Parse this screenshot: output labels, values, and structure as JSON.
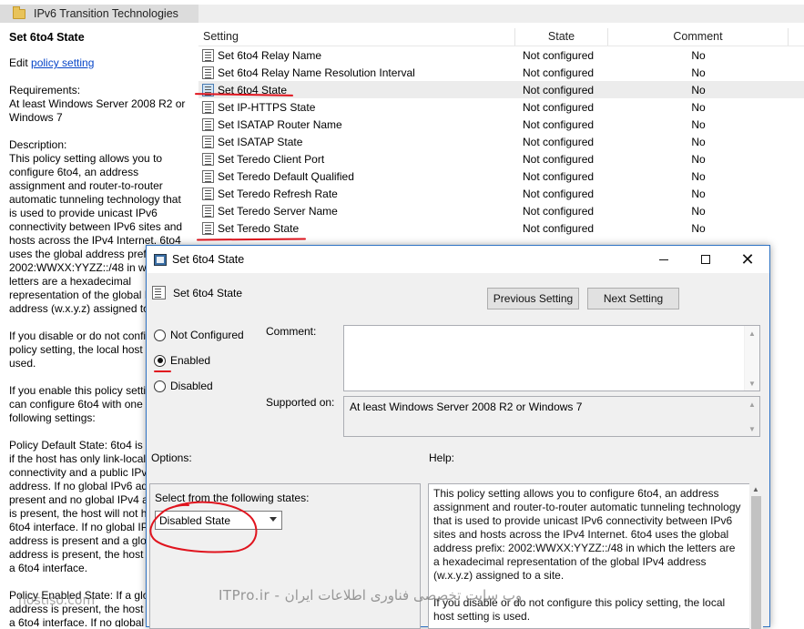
{
  "window": {
    "folder_title": "IPv6 Transition Technologies"
  },
  "left_pane": {
    "title": "Set 6to4 State",
    "edit_prefix": "Edit ",
    "edit_link": "policy setting",
    "requirements": "Requirements:\nAt least Windows Server 2008 R2 or Windows 7",
    "description": "Description:\nThis policy setting allows you to configure 6to4, an address assignment and router-to-router automatic tunneling technology that is used to provide unicast IPv6 connectivity between IPv6 sites and hosts across the IPv4 Internet. 6to4 uses the global address prefix: 2002:WWXX:YYZZ::/48 in which the letters are a hexadecimal representation of the global IPv4 address (w.x.y.z) assigned to a site.",
    "disable_text": "If you disable or do not configure this policy setting, the local host setting is used.",
    "enable_text": "If you enable this policy setting, you can configure 6to4 with one of the following settings:",
    "default_state": "Policy Default State: 6to4 is enabled if the host has only link-local IPv6 connectivity and a public IPv4 address. If no global IPv6 address is present and no global IPv4 address is present, the host will not have a 6to4 interface. If no global IPv6 address is present and a global IPv4 address is present, the host will have a 6to4 interface.",
    "enabled_state": "Policy Enabled State: If a global IPv4 address is present, the host will have a 6to4 interface. If no global"
  },
  "table": {
    "headers": {
      "setting": "Setting",
      "state": "State",
      "comment": "Comment"
    },
    "rows": [
      {
        "name": "Set 6to4 Relay Name",
        "state": "Not configured",
        "comment": "No"
      },
      {
        "name": "Set 6to4 Relay Name Resolution Interval",
        "state": "Not configured",
        "comment": "No"
      },
      {
        "name": "Set 6to4 State",
        "state": "Not configured",
        "comment": "No"
      },
      {
        "name": "Set IP-HTTPS State",
        "state": "Not configured",
        "comment": "No"
      },
      {
        "name": "Set ISATAP Router Name",
        "state": "Not configured",
        "comment": "No"
      },
      {
        "name": "Set ISATAP State",
        "state": "Not configured",
        "comment": "No"
      },
      {
        "name": "Set Teredo Client Port",
        "state": "Not configured",
        "comment": "No"
      },
      {
        "name": "Set Teredo Default Qualified",
        "state": "Not configured",
        "comment": "No"
      },
      {
        "name": "Set Teredo Refresh Rate",
        "state": "Not configured",
        "comment": "No"
      },
      {
        "name": "Set Teredo Server Name",
        "state": "Not configured",
        "comment": "No"
      },
      {
        "name": "Set Teredo State",
        "state": "Not configured",
        "comment": "No"
      }
    ]
  },
  "dialog": {
    "title": "Set 6to4 State",
    "header_label": "Set 6to4 State",
    "prev_button": "Previous Setting",
    "next_button": "Next Setting",
    "radio_not_configured": "Not Configured",
    "radio_enabled": "Enabled",
    "radio_disabled": "Disabled",
    "comment_label": "Comment:",
    "supported_label": "Supported on:",
    "supported_value": "At least Windows Server 2008 R2 or Windows 7",
    "options_label": "Options:",
    "help_label": "Help:",
    "select_label": "Select from the following states:",
    "select_value": "Disabled State",
    "help_p1": "This policy setting allows you to configure 6to4, an address assignment and router-to-router automatic tunneling technology that is used to provide unicast IPv6 connectivity between IPv6 sites and hosts across the IPv4 Internet. 6to4 uses the global address prefix: 2002:WWXX:YYZZ::/48 in which the letters are a hexadecimal representation of the global IPv4 address (w.x.y.z) assigned to a site.",
    "help_p2": "If you disable or do not configure this policy setting, the local host setting is used."
  },
  "watermark": {
    "main": "ITPro.ir - وب سایت تخصصی فناوری اطلاعات ایران",
    "corner": "hostiso.com"
  },
  "colors": {
    "annotation": "#e0141e",
    "link": "#0645c8",
    "dialog_border": "#2f73c4"
  }
}
